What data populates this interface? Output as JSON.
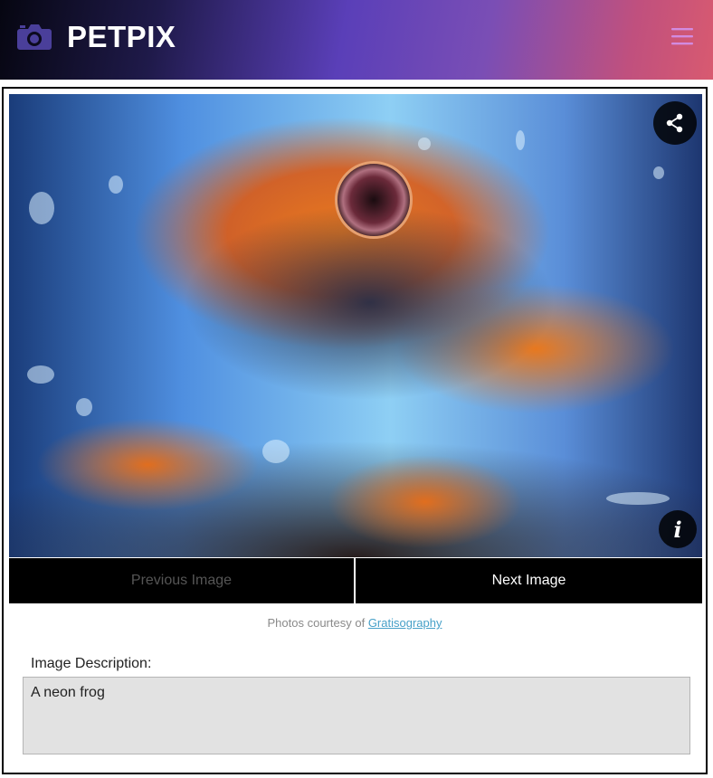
{
  "header": {
    "brand": "PETPIX",
    "logo_icon": "camera-icon",
    "menu_icon": "hamburger-menu-icon",
    "accent_color": "#5a3fb8",
    "menu_icon_color": "#d28be0"
  },
  "gallery": {
    "image_subject": "A neon frog",
    "share_icon": "share-icon",
    "info_icon_glyph": "i",
    "prev_label": "Previous Image",
    "next_label": "Next Image"
  },
  "credit": {
    "prefix": "Photos courtesy of",
    "link_text": "Gratisography",
    "link_color": "#47a0c8"
  },
  "description": {
    "label": "Image Description:",
    "value": "A neon frog"
  }
}
